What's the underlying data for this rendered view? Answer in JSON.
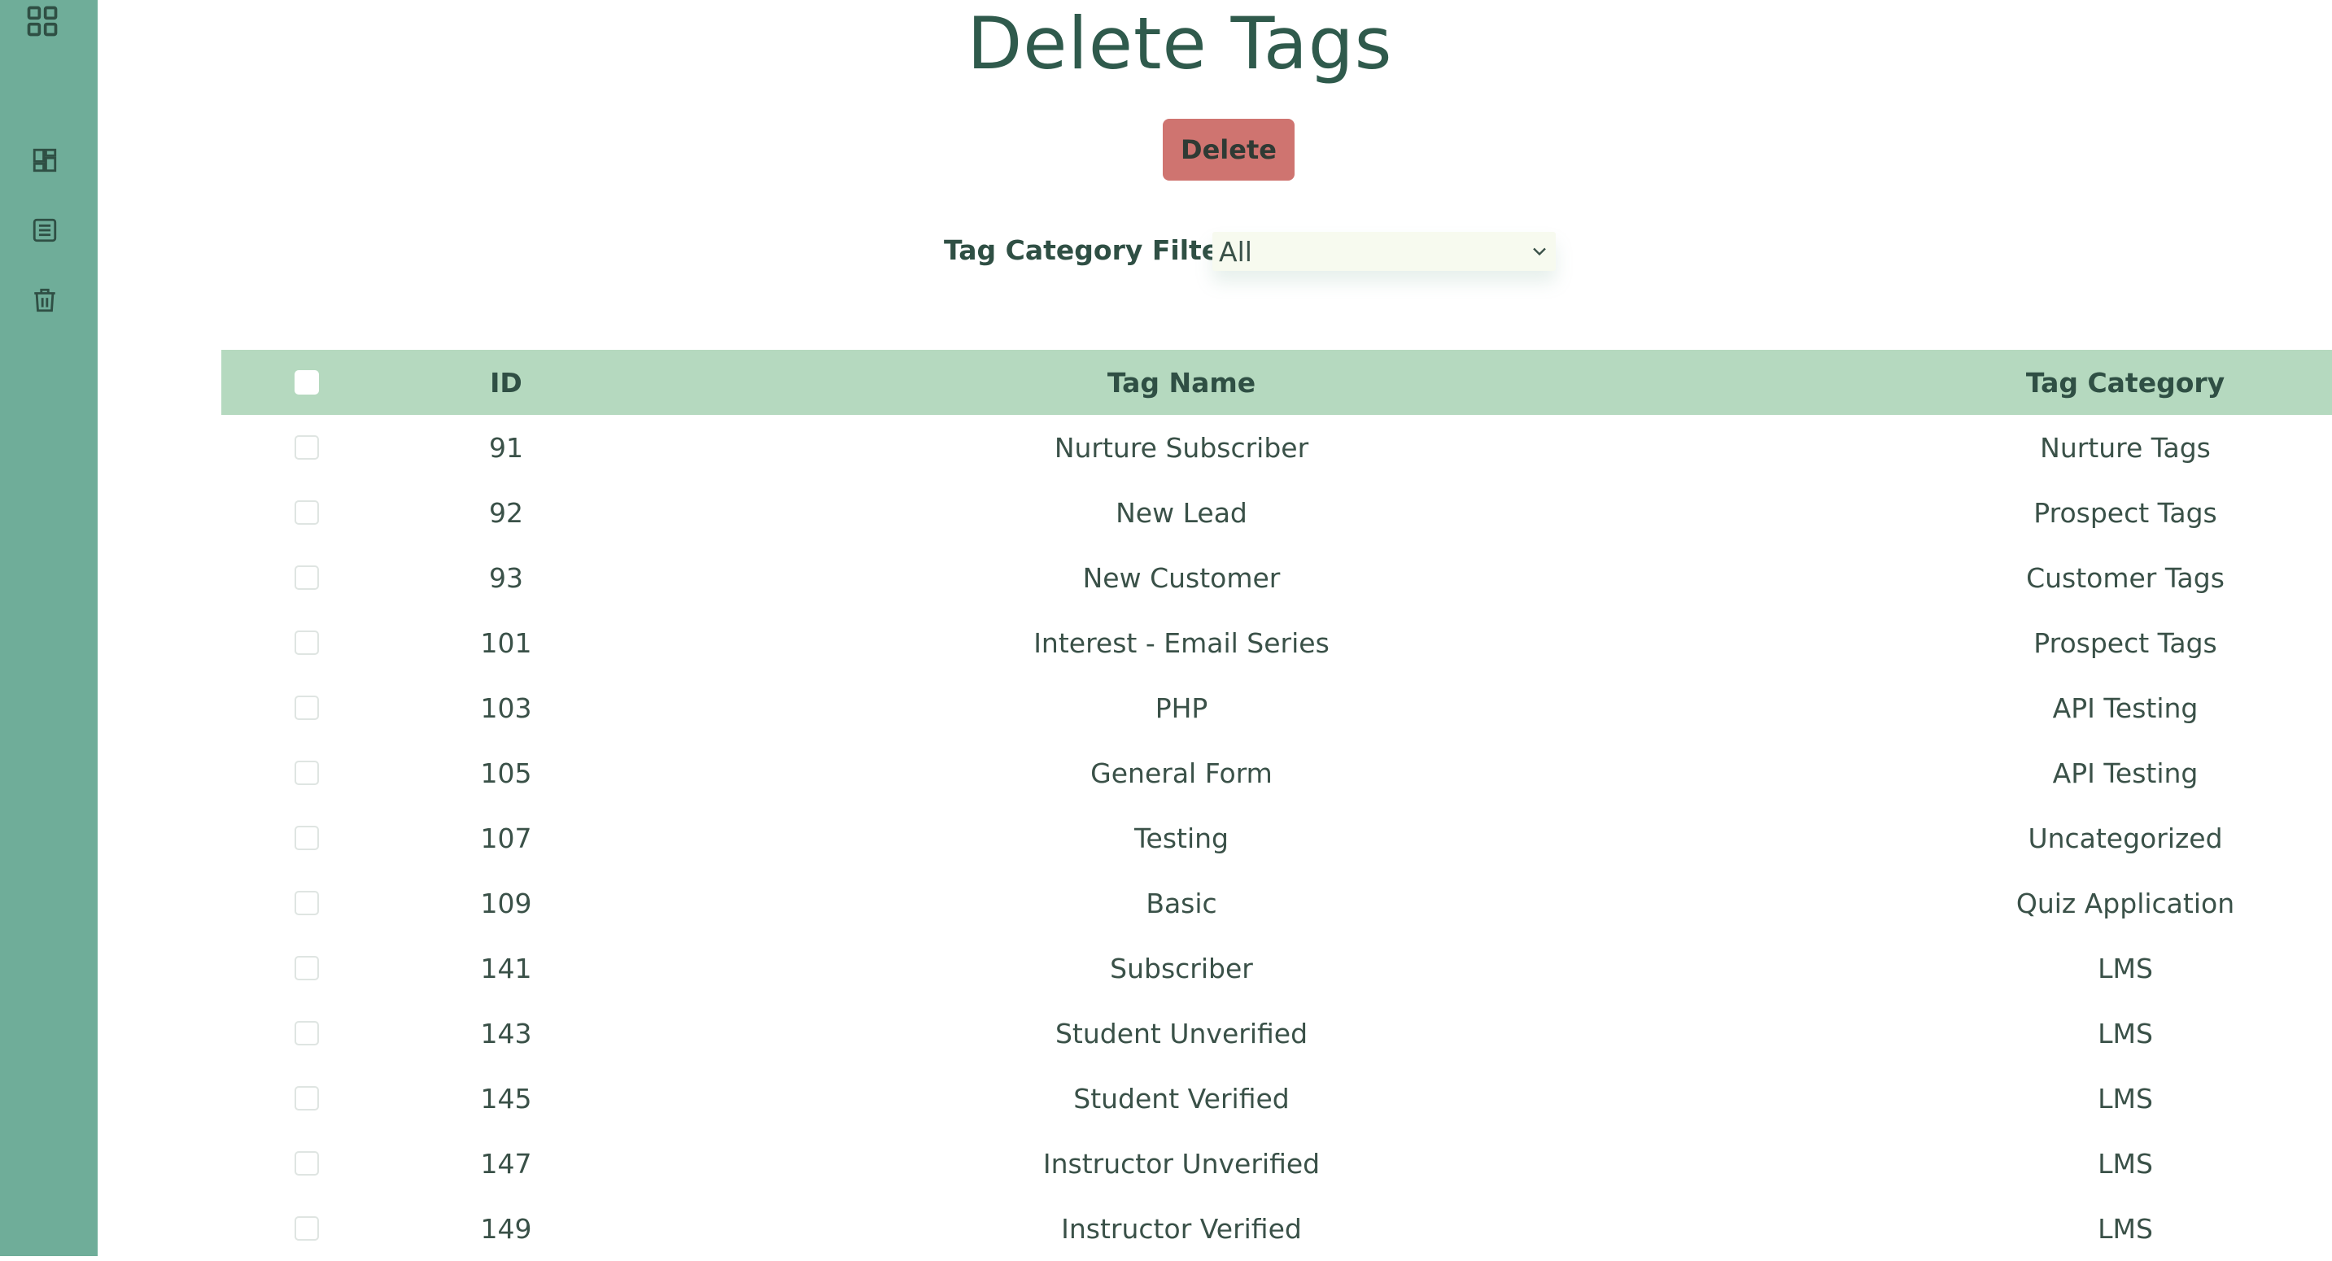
{
  "sidebar": {
    "icons": [
      "apps-grid-icon",
      "dashboard-icon",
      "list-icon",
      "trash-icon"
    ]
  },
  "page": {
    "title": "Delete Tags",
    "delete_label": "Delete",
    "filter_label": "Tag Category Filter",
    "filter_value": "All"
  },
  "colors": {
    "sidebar": "#6fad99",
    "header_row": "#b5d9bf",
    "delete_button": "#cf7470",
    "title": "#2f5a4c"
  },
  "table": {
    "headers": {
      "id": "ID",
      "name": "Tag Name",
      "category": "Tag Category"
    },
    "rows": [
      {
        "id": "91",
        "name": "Nurture Subscriber",
        "category": "Nurture Tags"
      },
      {
        "id": "92",
        "name": "New Lead",
        "category": "Prospect Tags"
      },
      {
        "id": "93",
        "name": "New Customer",
        "category": "Customer Tags"
      },
      {
        "id": "101",
        "name": "Interest - Email Series",
        "category": "Prospect Tags"
      },
      {
        "id": "103",
        "name": "PHP",
        "category": "API Testing"
      },
      {
        "id": "105",
        "name": "General Form",
        "category": "API Testing"
      },
      {
        "id": "107",
        "name": "Testing",
        "category": "Uncategorized"
      },
      {
        "id": "109",
        "name": "Basic",
        "category": "Quiz Application"
      },
      {
        "id": "141",
        "name": "Subscriber",
        "category": "LMS"
      },
      {
        "id": "143",
        "name": "Student Unverified",
        "category": "LMS"
      },
      {
        "id": "145",
        "name": "Student Verified",
        "category": "LMS"
      },
      {
        "id": "147",
        "name": "Instructor Unverified",
        "category": "LMS"
      },
      {
        "id": "149",
        "name": "Instructor Verified",
        "category": "LMS"
      }
    ]
  }
}
